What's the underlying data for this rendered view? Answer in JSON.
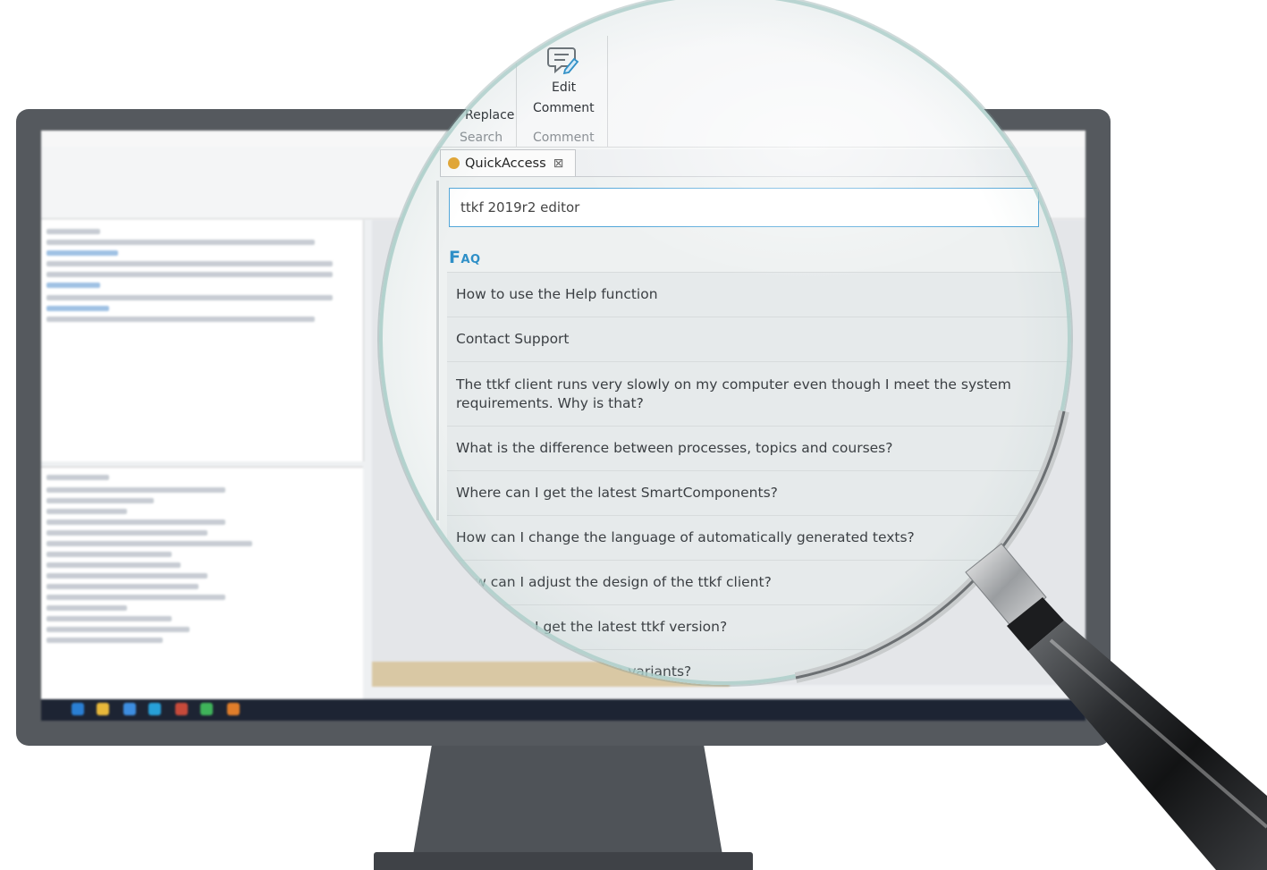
{
  "ribbon": {
    "replace_label": "Replace",
    "search_group": "Search",
    "edit_comment_line1": "Edit",
    "edit_comment_line2": "Comment",
    "comment_group": "Comment"
  },
  "tab": {
    "label": "QuickAccess",
    "close_glyph": "⊠"
  },
  "search": {
    "value": "ttkf 2019r2 editor"
  },
  "faq": {
    "title": "Faq",
    "items": [
      "How to use the Help function",
      "Contact Support",
      "The ttkf client runs very slowly on my computer even though I meet the system requirements. Why is that?",
      "What is the difference between processes, topics and courses?",
      "Where can I get the latest SmartComponents?",
      "How can I change the language of automatically generated texts?",
      "How can I adjust the design of the ttkf client?",
      "Where can I get the latest ttkf version?",
      "How can I add language variants?"
    ]
  },
  "colors": {
    "accent": "#2e8fc7",
    "search_border": "#52a6d9",
    "monitor": "#55595e",
    "taskbar": "#1d2433"
  },
  "icons": [
    "edit-comment-icon",
    "quickaccess-tab-icon",
    "close-tab-icon",
    "magnifier-handle-icon"
  ]
}
